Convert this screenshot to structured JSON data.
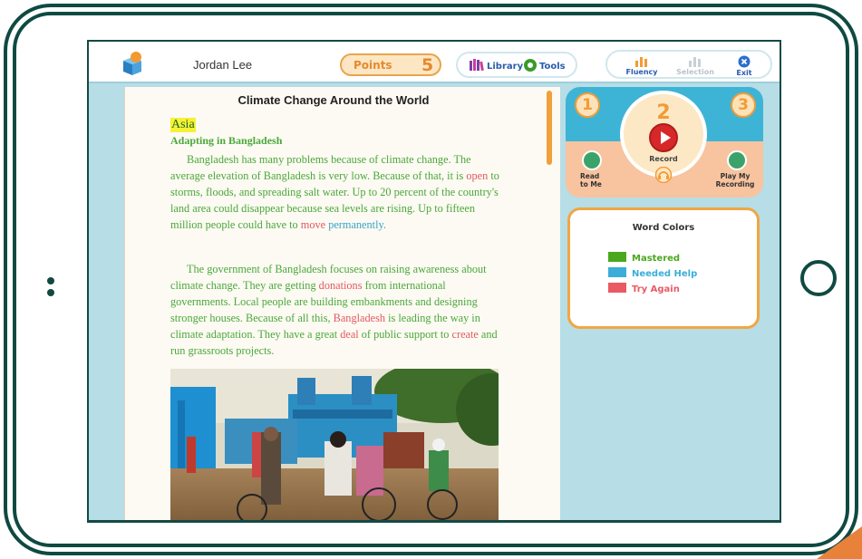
{
  "header": {
    "user_name": "Jordan Lee",
    "points_label": "Points",
    "points_value": "5",
    "library_label": "Library",
    "tools_label": "Tools",
    "fluency_label": "Fluency",
    "selection_label": "Selection",
    "exit_label": "Exit"
  },
  "reader": {
    "title": "Climate Change Around the World",
    "section": "Asia",
    "subheading": "Adapting in Bangladesh",
    "paragraph1": [
      {
        "t": "Bangladesh has many problems because of climate change. The average elevation of Bangladesh is very low. Because of that, it is ",
        "c": "g"
      },
      {
        "t": "open",
        "c": "r"
      },
      {
        "t": " to storms, floods, and spreading salt water. Up to 20 percent of the country's land area could disappear because sea levels are rising. Up to fifteen million people could have to ",
        "c": "g"
      },
      {
        "t": "move",
        "c": "r"
      },
      {
        "t": " ",
        "c": "g"
      },
      {
        "t": "permanently",
        "c": "b"
      },
      {
        "t": ".",
        "c": "g"
      }
    ],
    "paragraph2": [
      {
        "t": "The government of Bangladesh focuses on raising awareness about climate change. They are getting ",
        "c": "g"
      },
      {
        "t": "donations",
        "c": "r"
      },
      {
        "t": " from international governments. Local people are building embankments and designing stronger houses. Because of all this, ",
        "c": "g"
      },
      {
        "t": "Bangladesh",
        "c": "r"
      },
      {
        "t": " is leading the way in climate adaptation. They have a great ",
        "c": "g"
      },
      {
        "t": "deal",
        "c": "r"
      },
      {
        "t": " of public support to ",
        "c": "g"
      },
      {
        "t": "create",
        "c": "r"
      },
      {
        "t": " and run grassroots projects.",
        "c": "g"
      }
    ]
  },
  "controls": {
    "step1": "1",
    "step2": "2",
    "step3": "3",
    "record_label": "Record",
    "read_to_me_line1": "Read",
    "read_to_me_line2": "to Me",
    "play_line1": "Play My",
    "play_line2": "Recording"
  },
  "legend": {
    "title": "Word Colors",
    "items": [
      {
        "label": "Mastered",
        "color": "#4aa81e"
      },
      {
        "label": "Needed Help",
        "color": "#3aaed8"
      },
      {
        "label": "Try Again",
        "color": "#e95a63"
      }
    ]
  },
  "colors": {
    "frame": "#0f4a42",
    "accent_orange": "#f29b34",
    "mastered": "#4aa83a",
    "try_again": "#e05a63",
    "needed_help": "#3aa3c9"
  }
}
